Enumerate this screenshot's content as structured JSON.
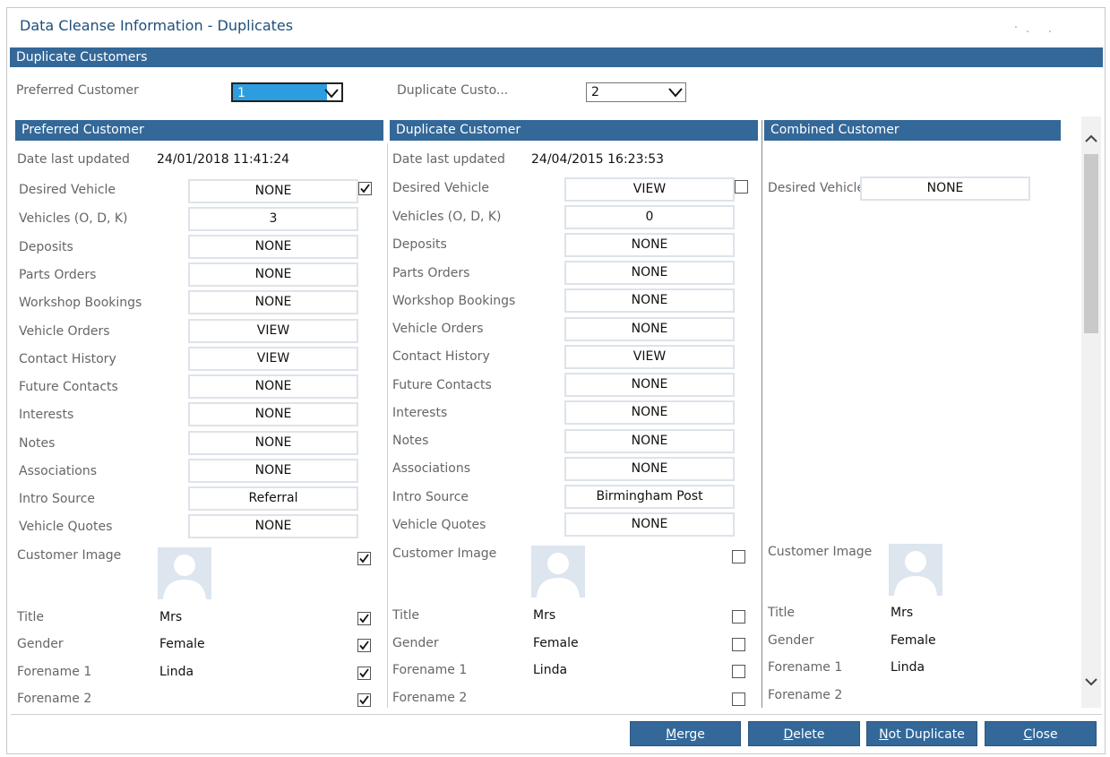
{
  "window": {
    "title": "Data Cleanse Information - Duplicates"
  },
  "section_title": "Duplicate Customers",
  "selectors": {
    "preferred_label": "Preferred Customer",
    "preferred_value": "1",
    "duplicate_label": "Duplicate Custo...",
    "duplicate_value": "2"
  },
  "columns": {
    "preferred": {
      "header": "Preferred Customer",
      "date_label": "Date last updated",
      "date_value": "24/01/2018 11:41:24",
      "rows": [
        {
          "label": "Desired Vehicle",
          "value": "NONE"
        },
        {
          "label": "Vehicles (O, D, K)",
          "value": "3"
        },
        {
          "label": "Deposits",
          "value": "NONE"
        },
        {
          "label": "Parts Orders",
          "value": "NONE"
        },
        {
          "label": "Workshop Bookings",
          "value": "NONE"
        },
        {
          "label": "Vehicle Orders",
          "value": "VIEW"
        },
        {
          "label": "Contact History",
          "value": "VIEW"
        },
        {
          "label": "Future Contacts",
          "value": "NONE"
        },
        {
          "label": "Interests",
          "value": "NONE"
        },
        {
          "label": "Notes",
          "value": "NONE"
        },
        {
          "label": "Associations",
          "value": "NONE"
        },
        {
          "label": "Intro Source",
          "value": "Referral"
        },
        {
          "label": "Vehicle Quotes",
          "value": "NONE"
        }
      ],
      "image_label": "Customer Image",
      "fields": [
        {
          "label": "Title",
          "value": "Mrs"
        },
        {
          "label": "Gender",
          "value": "Female"
        },
        {
          "label": "Forename 1",
          "value": "Linda"
        },
        {
          "label": "Forename 2",
          "value": ""
        }
      ]
    },
    "duplicate": {
      "header": "Duplicate Customer",
      "date_label": "Date last updated",
      "date_value": "24/04/2015 16:23:53",
      "rows": [
        {
          "label": "Desired Vehicle",
          "value": "VIEW"
        },
        {
          "label": "Vehicles (O, D, K)",
          "value": "0"
        },
        {
          "label": "Deposits",
          "value": "NONE"
        },
        {
          "label": "Parts Orders",
          "value": "NONE"
        },
        {
          "label": "Workshop Bookings",
          "value": "NONE"
        },
        {
          "label": "Vehicle Orders",
          "value": "NONE"
        },
        {
          "label": "Contact History",
          "value": "VIEW"
        },
        {
          "label": "Future Contacts",
          "value": "NONE"
        },
        {
          "label": "Interests",
          "value": "NONE"
        },
        {
          "label": "Notes",
          "value": "NONE"
        },
        {
          "label": "Associations",
          "value": "NONE"
        },
        {
          "label": "Intro Source",
          "value": "Birmingham Post"
        },
        {
          "label": "Vehicle Quotes",
          "value": "NONE"
        }
      ],
      "image_label": "Customer Image",
      "fields": [
        {
          "label": "Title",
          "value": "Mrs"
        },
        {
          "label": "Gender",
          "value": "Female"
        },
        {
          "label": "Forename 1",
          "value": "Linda"
        },
        {
          "label": "Forename 2",
          "value": ""
        }
      ]
    },
    "combined": {
      "header": "Combined Customer",
      "desired_label": "Desired Vehicle",
      "desired_value": "NONE",
      "image_label": "Customer Image",
      "fields": [
        {
          "label": "Title",
          "value": "Mrs"
        },
        {
          "label": "Gender",
          "value": "Female"
        },
        {
          "label": "Forename 1",
          "value": "Linda"
        },
        {
          "label": "Forename 2",
          "value": ""
        }
      ]
    }
  },
  "checkboxes": {
    "preferred": {
      "desired_vehicle": true,
      "customer_image": true,
      "title": true,
      "gender": true,
      "forename_1": true,
      "forename_2": true
    },
    "duplicate": {
      "desired_vehicle": false,
      "customer_image": false,
      "title": false,
      "gender": false,
      "forename_1": false,
      "forename_2": false
    }
  },
  "buttons": {
    "merge": {
      "accel": "M",
      "rest": "erge"
    },
    "delete": {
      "accel": "D",
      "rest": "elete"
    },
    "not_duplicate": {
      "accel": "N",
      "rest": "ot Duplicate"
    },
    "close": {
      "accel": "C",
      "rest": "lose"
    }
  },
  "colors": {
    "header_blue": "#336899",
    "title_blue": "#1f4e7a",
    "select_highlight": "#2c9ee0"
  }
}
